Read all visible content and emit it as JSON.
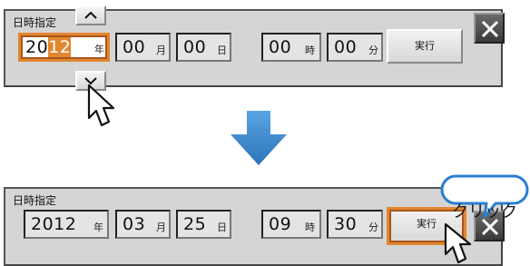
{
  "top_panel": {
    "title": "日時指定",
    "year_prefix": "20",
    "year_highlight": "12",
    "year_unit": "年",
    "month_value": "00",
    "month_unit": "月",
    "day_value": "00",
    "day_unit": "日",
    "hour_value": "00",
    "hour_unit": "時",
    "minute_value": "00",
    "minute_unit": "分",
    "execute_label": "実行",
    "up_icon": "chevron-up-icon",
    "down_icon": "chevron-down-icon",
    "close_icon": "close-icon"
  },
  "transition_icon": "down-arrow-icon",
  "bottom_panel": {
    "title": "日時指定",
    "year_value": "2012",
    "year_unit": "年",
    "month_value": "03",
    "month_unit": "月",
    "day_value": "25",
    "day_unit": "日",
    "hour_value": "09",
    "hour_unit": "時",
    "minute_value": "30",
    "minute_unit": "分",
    "execute_label": "実行",
    "callout_text": "クリック"
  },
  "colors": {
    "panel_bg": "#d5d5d5",
    "selection_orange": "#e2862f",
    "arrow_blue": "#3a86cc"
  }
}
